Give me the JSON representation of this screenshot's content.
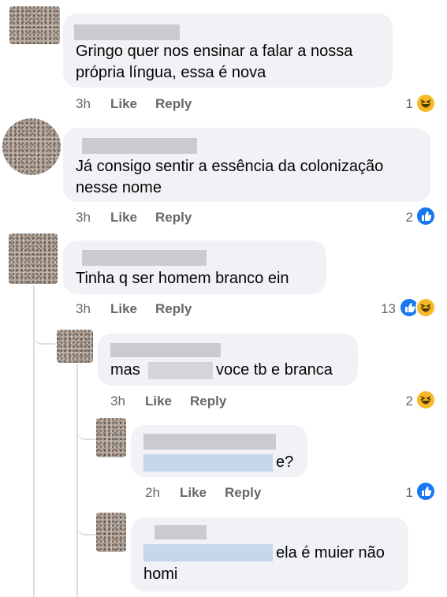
{
  "colors": {
    "like_blue": "#1877f2",
    "haha_yellow": "#f7b928",
    "bubble": "#f0f2f5",
    "meta_gray": "#65676b"
  },
  "comments": [
    {
      "line1": "Gringo quer nos ensinar a falar a nossa",
      "line2": "própria língua, essa é nova",
      "time": "3h",
      "like": "Like",
      "reply": "Reply",
      "count": "1",
      "reactions": [
        "haha-icon"
      ]
    },
    {
      "line1": "Já consigo sentir a essência da colonização",
      "line2": "nesse nome",
      "time": "3h",
      "like": "Like",
      "reply": "Reply",
      "count": "2",
      "reactions": [
        "like-icon"
      ]
    },
    {
      "line1": "Tinha q ser homem branco ein",
      "time": "3h",
      "like": "Like",
      "reply": "Reply",
      "count": "13",
      "reactions": [
        "like-icon",
        "haha-icon"
      ]
    }
  ],
  "replies": [
    {
      "prefix": "mas",
      "suffix": "voce tb e branca",
      "time": "3h",
      "like": "Like",
      "reply": "Reply",
      "count": "2",
      "reactions": [
        "haha-icon"
      ]
    },
    {
      "suffix": "e?",
      "time": "2h",
      "like": "Like",
      "reply": "Reply",
      "count": "1",
      "reactions": [
        "like-icon"
      ]
    },
    {
      "suffix": "ela é muier não",
      "line2": "homi"
    }
  ]
}
